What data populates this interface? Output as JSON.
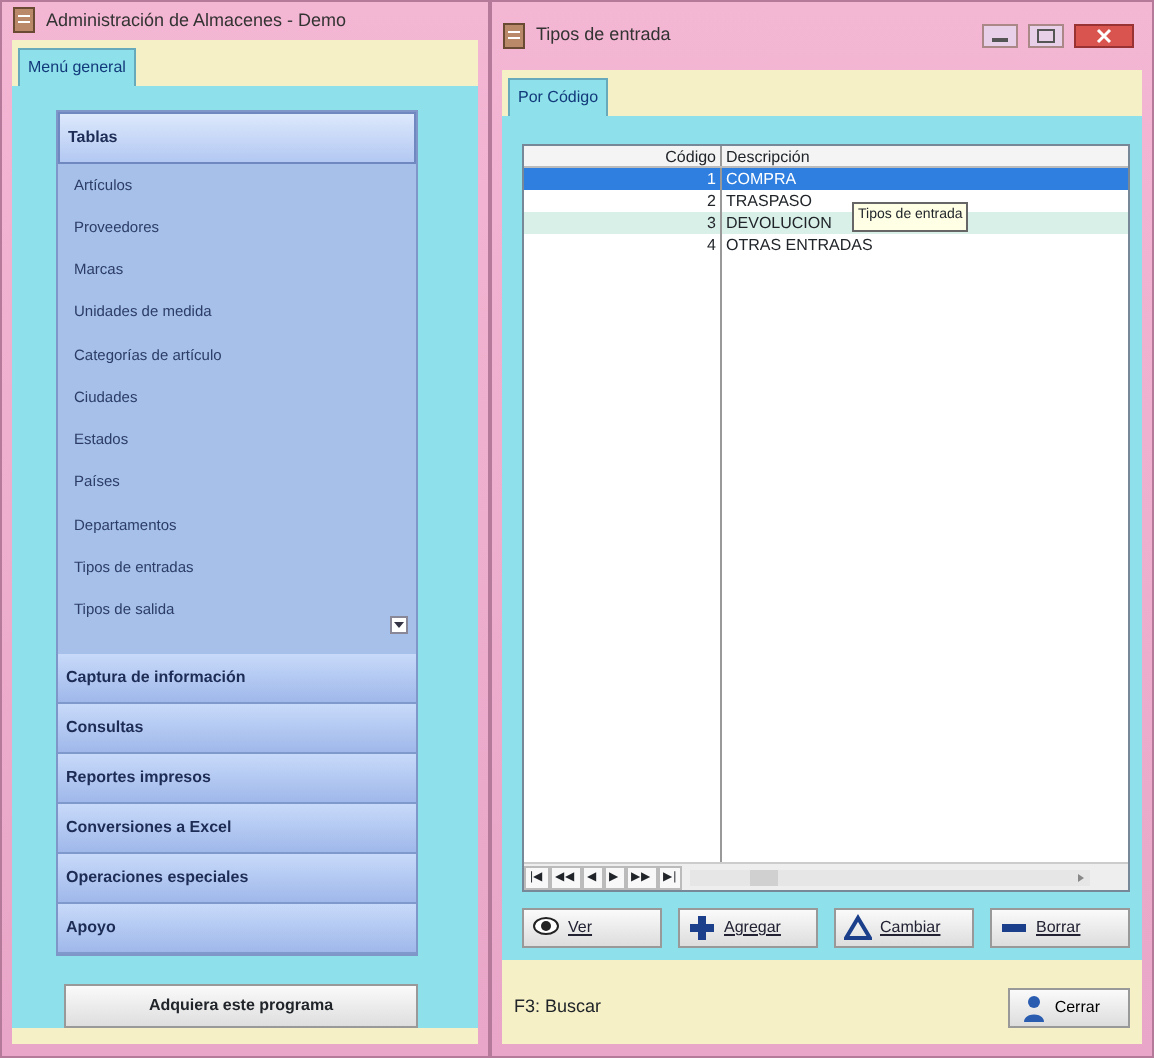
{
  "menu_window": {
    "title": "Administración de Almacenes - Demo",
    "tabs": [
      {
        "label": "Menú general",
        "selected": true
      }
    ],
    "sections": [
      {
        "label": "Tablas",
        "expanded": true,
        "items": [
          "Artículos",
          "Proveedores",
          "Marcas",
          "Unidades de medida",
          "Categorías de artículo",
          "Ciudades",
          "Estados",
          "Países",
          "Departamentos",
          "Tipos de entradas",
          "Tipos de salida"
        ]
      },
      {
        "label": "Captura de información",
        "expanded": false
      },
      {
        "label": "Consultas",
        "expanded": false
      },
      {
        "label": "Reportes impresos",
        "expanded": false
      },
      {
        "label": "Conversiones a Excel",
        "expanded": false
      },
      {
        "label": "Operaciones especiales",
        "expanded": false
      },
      {
        "label": "Apoyo",
        "expanded": false
      }
    ],
    "button": "Adquiera este programa"
  },
  "entry_window": {
    "title": "Tipos de entrada",
    "tabs": [
      {
        "label": "Por Código",
        "selected": true
      }
    ],
    "table": {
      "columns": [
        "Código",
        "Descripción"
      ],
      "rows": [
        {
          "code": "1",
          "description": "COMPRA",
          "selected": true,
          "highlighted": false
        },
        {
          "code": "2",
          "description": "TRASPASO",
          "selected": false,
          "highlighted": false
        },
        {
          "code": "3",
          "description": "DEVOLUCION",
          "selected": false,
          "highlighted": true
        },
        {
          "code": "4",
          "description": "OTRAS ENTRADAS",
          "selected": false,
          "highlighted": false
        }
      ]
    },
    "tooltip": "Tipos de entrada",
    "navigator": [
      "|◀",
      "◀◀",
      "◀",
      "▶",
      "▶▶",
      "▶|"
    ],
    "actions": [
      {
        "kind": "view",
        "label": "Ver"
      },
      {
        "kind": "add",
        "label": "Agregar"
      },
      {
        "kind": "edit",
        "label": "Cambiar"
      },
      {
        "kind": "delete",
        "label": "Borrar"
      }
    ],
    "status": "F3: Buscar",
    "close_button": "Cerrar"
  }
}
